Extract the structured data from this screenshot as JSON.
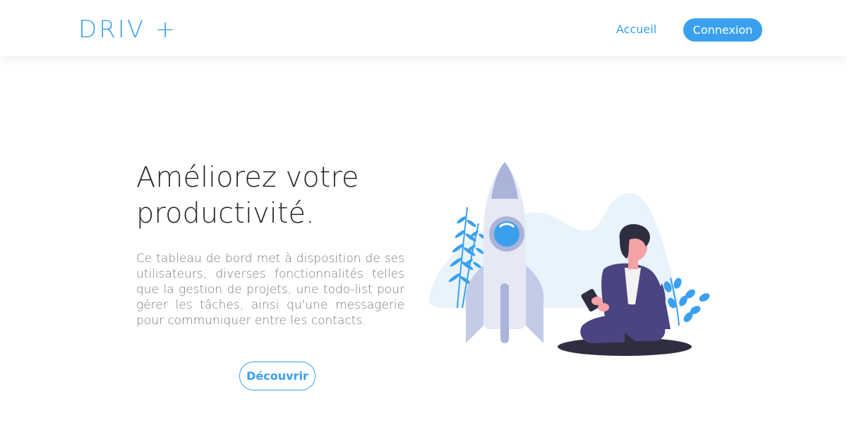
{
  "nav": {
    "logo": "DRIV +",
    "home_label": "Accueil",
    "login_label": "Connexion"
  },
  "hero": {
    "title": "Améliorez votre productivité.",
    "description": "Ce tableau de bord met à disposition de ses utilisateurs, diverses fonctionnalités telles que la gestion de projets, une todo-list pour gérer les tâches, ainsi qu'une messagerie pour communiquer entre les contacts.",
    "cta_label": "Découvrir"
  },
  "colors": {
    "accent": "#3aa0ee",
    "title_text": "#2b2b2b",
    "body_text": "#7a7a7a",
    "illustration_suit": "#4a4580",
    "illustration_rocket": "#e6e9f4"
  },
  "illustration": {
    "icon": "rocket-person-illustration"
  }
}
